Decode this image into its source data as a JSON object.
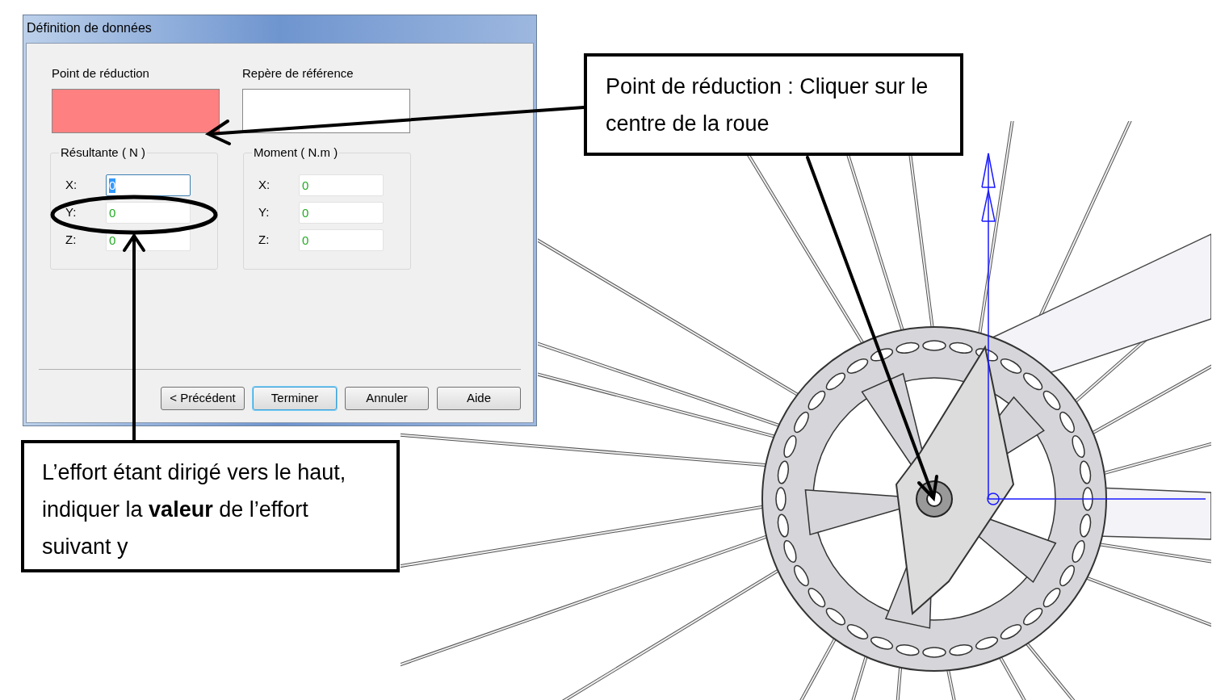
{
  "dialog": {
    "title": "Définition de données",
    "selectors": [
      {
        "label": "Point de réduction",
        "highlighted": true
      },
      {
        "label": "Repère de référence",
        "highlighted": false
      }
    ],
    "groups": [
      {
        "title": "Résultante ( N )",
        "fields": [
          {
            "label": "X:",
            "value": "0",
            "focused": true
          },
          {
            "label": "Y:",
            "value": "0",
            "focused": false
          },
          {
            "label": "Z:",
            "value": "0",
            "focused": false
          }
        ]
      },
      {
        "title": "Moment ( N.m )",
        "fields": [
          {
            "label": "X:",
            "value": "0",
            "focused": false
          },
          {
            "label": "Y:",
            "value": "0",
            "focused": false
          },
          {
            "label": "Z:",
            "value": "0",
            "focused": false
          }
        ]
      }
    ],
    "buttons": [
      {
        "label": "< Précédent",
        "default": false
      },
      {
        "label": "Terminer",
        "default": true
      },
      {
        "label": "Annuler",
        "default": false
      },
      {
        "label": "Aide",
        "default": false
      }
    ]
  },
  "callouts": [
    {
      "text": "Point de réduction : Cliquer sur le centre de la roue"
    },
    {
      "text": "L’effort étant dirigé vers le haut, indiquer la **valeur** de l’effort suivant y"
    }
  ]
}
